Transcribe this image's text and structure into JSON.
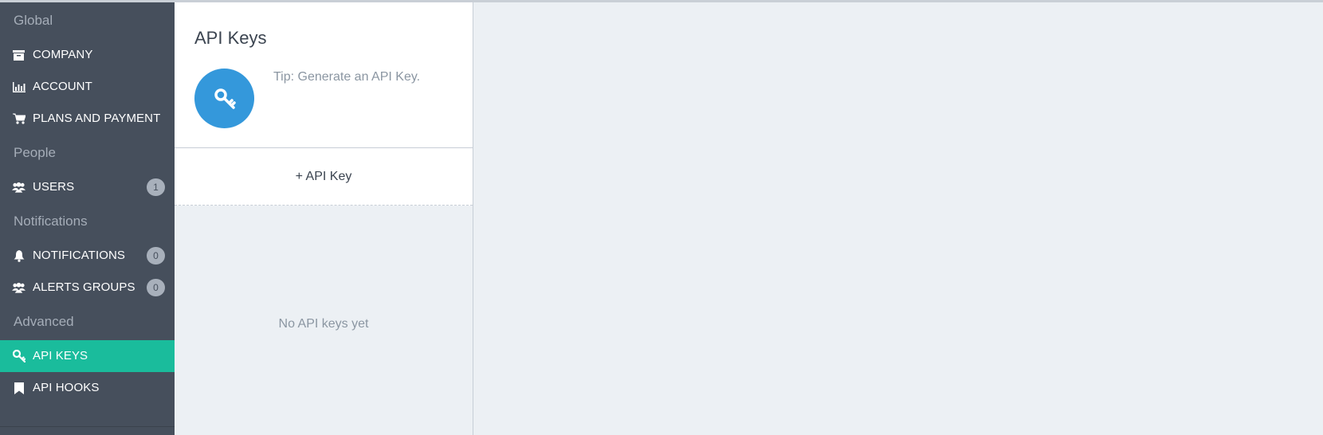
{
  "sidebar": {
    "sections": {
      "global": "Global",
      "people": "People",
      "notifications": "Notifications",
      "advanced": "Advanced"
    },
    "items": {
      "company": {
        "label": "COMPANY",
        "icon": "archive-icon"
      },
      "account": {
        "label": "ACCOUNT",
        "icon": "bar-chart-icon"
      },
      "plans": {
        "label": "PLANS AND PAYMENT",
        "icon": "cart-icon"
      },
      "users": {
        "label": "USERS",
        "icon": "users-icon",
        "badge": "1"
      },
      "notifications": {
        "label": "NOTIFICATIONS",
        "icon": "bell-icon",
        "badge": "0"
      },
      "alerts_groups": {
        "label": "ALERTS GROUPS",
        "icon": "users-icon",
        "badge": "0"
      },
      "api_keys": {
        "label": "API KEYS",
        "icon": "key-icon",
        "active": true
      },
      "api_hooks": {
        "label": "API HOOKS",
        "icon": "bookmark-icon"
      }
    }
  },
  "panel": {
    "title": "API Keys",
    "tip": "Tip: Generate an API Key.",
    "add_button": "+ API Key",
    "empty_message": "No API keys yet"
  },
  "colors": {
    "sidebar_bg": "#464f5c",
    "active": "#1abc9c",
    "accent_blue": "#3498db",
    "content_bg": "#ecf0f4"
  }
}
